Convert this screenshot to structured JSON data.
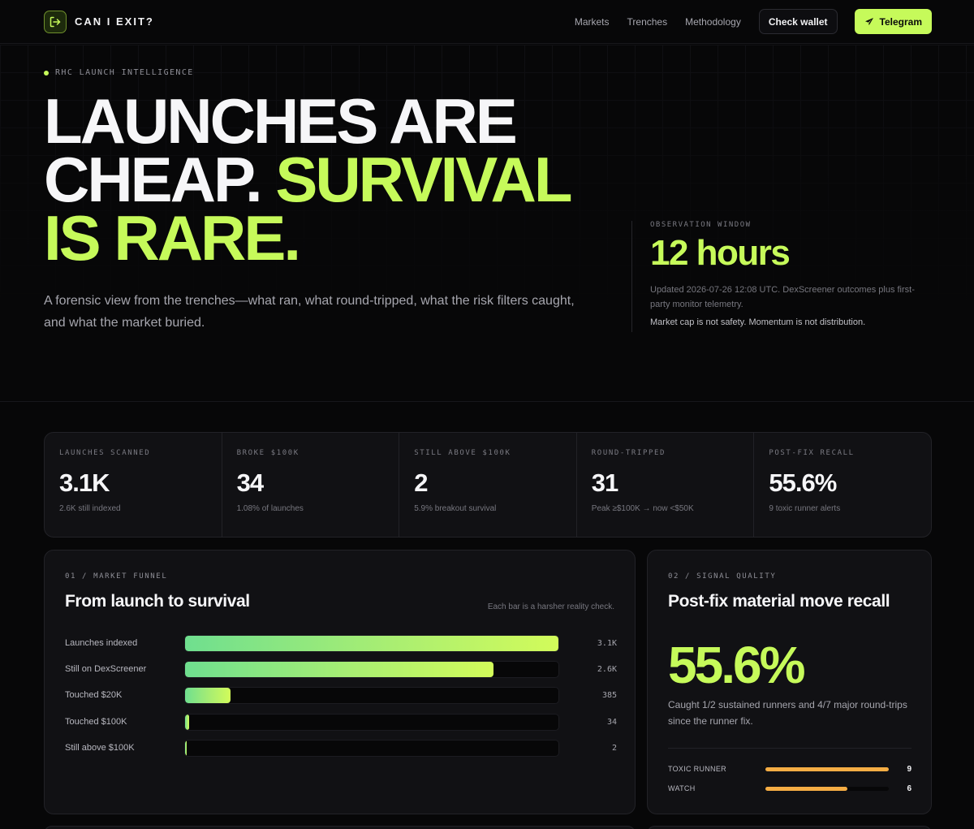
{
  "nav": {
    "brand": "CAN I EXIT?",
    "links": [
      "Markets",
      "Trenches",
      "Methodology"
    ],
    "wallet_button": "Check wallet",
    "telegram_button": "Telegram"
  },
  "hero": {
    "eyebrow": "RHC LAUNCH INTELLIGENCE",
    "headline": {
      "line1": "LAUNCHES ARE",
      "line2_white": "CHEAP.",
      "line2_lime": "SURVIVAL",
      "line3": "IS RARE."
    },
    "subtitle": "A forensic view from the trenches—what ran, what round-tripped, what the risk filters caught, and what the market buried.",
    "observation": {
      "label": "OBSERVATION WINDOW",
      "value": "12 hours",
      "updated": "Updated 2026-07-26 12:08 UTC. DexScreener outcomes plus first-party monitor telemetry.",
      "note": "Market cap is not safety. Momentum is not distribution."
    }
  },
  "stats": [
    {
      "label": "LAUNCHES SCANNED",
      "value": "3.1K",
      "sub": "2.6K still indexed"
    },
    {
      "label": "BROKE $100K",
      "value": "34",
      "sub": "1.08% of launches"
    },
    {
      "label": "STILL ABOVE $100K",
      "value": "2",
      "sub": "5.9% breakout survival"
    },
    {
      "label": "ROUND-TRIPPED",
      "value": "31",
      "sub": "Peak ≥$100K → now <$50K"
    },
    {
      "label": "POST-FIX RECALL",
      "value": "55.6%",
      "sub": "9 toxic runner alerts"
    }
  ],
  "funnel": {
    "eyebrow": "01 / MARKET FUNNEL",
    "title": "From launch to survival",
    "hint": "Each bar is a harsher reality check.",
    "rows": [
      {
        "label": "Launches indexed",
        "value": "3.1K",
        "fraction": 1.0
      },
      {
        "label": "Still on DexScreener",
        "value": "2.6K",
        "fraction": 0.827
      },
      {
        "label": "Touched $20K",
        "value": "385",
        "fraction": 0.122
      },
      {
        "label": "Touched $100K",
        "value": "34",
        "fraction": 0.011
      },
      {
        "label": "Still above $100K",
        "value": "2",
        "fraction": 0.0006
      }
    ]
  },
  "signal": {
    "eyebrow": "02 / SIGNAL QUALITY",
    "title": "Post-fix material move recall",
    "value": "55.6%",
    "description": "Caught 1/2 sustained runners and 4/7 major round-trips since the runner fix.",
    "rows": [
      {
        "label": "TOXIC RUNNER",
        "value": "9",
        "fraction": 1.0
      },
      {
        "label": "WATCH",
        "value": "6",
        "fraction": 0.667
      }
    ]
  },
  "colors": {
    "accent": "#c6fa5a",
    "warning": "#f5ad44",
    "background": "#070708",
    "card": "#111114"
  }
}
